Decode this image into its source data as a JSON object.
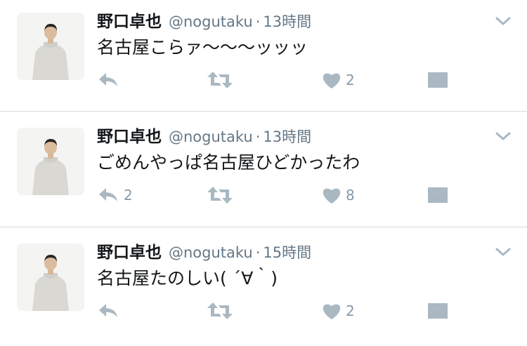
{
  "tweets": [
    {
      "name": "野口卓也",
      "handle": "@nogutaku",
      "separator": "·",
      "time": "13時間",
      "text": "名古屋こらァ〜〜〜ッッッ",
      "reply_count": "",
      "like_count": "2",
      "icons": [
        "reply-icon",
        "retweet-icon",
        "heart-icon",
        "envelope-icon",
        "chevron-down-icon"
      ]
    },
    {
      "name": "野口卓也",
      "handle": "@nogutaku",
      "separator": "·",
      "time": "13時間",
      "text": "ごめんやっぱ名古屋ひどかったわ",
      "reply_count": "2",
      "like_count": "8",
      "icons": [
        "reply-icon",
        "retweet-icon",
        "heart-icon",
        "envelope-icon",
        "chevron-down-icon"
      ]
    },
    {
      "name": "野口卓也",
      "handle": "@nogutaku",
      "separator": "·",
      "time": "15時間",
      "text": "名古屋たのしい( ´∀｀)",
      "reply_count": "",
      "like_count": "2",
      "icons": [
        "reply-icon",
        "retweet-icon",
        "heart-icon",
        "envelope-icon",
        "chevron-down-icon"
      ]
    }
  ],
  "colors": {
    "text": "#14171a",
    "secondary": "#657786",
    "icon": "#aab8c2",
    "divider": "#d6d9dc",
    "background": "#ffffff"
  }
}
